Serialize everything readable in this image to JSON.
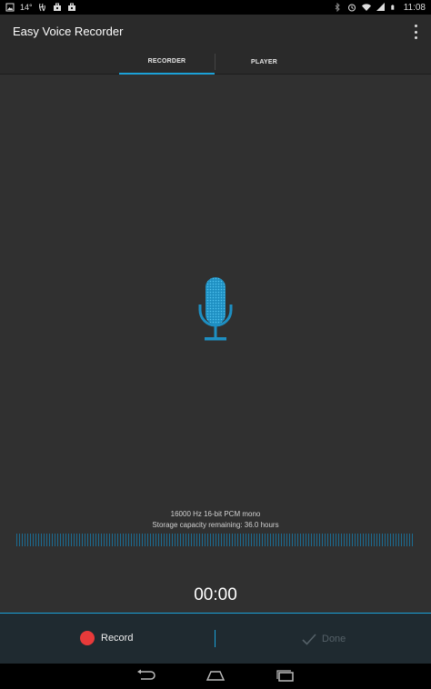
{
  "status_bar": {
    "left_icons": [
      "gallery-icon",
      "temperature-text",
      "hangouts-icon",
      "briefcase-icon",
      "briefcase-icon"
    ],
    "temperature": "14°",
    "right_icons": [
      "bluetooth-icon",
      "alarm-icon",
      "wifi-icon",
      "signal-icon",
      "battery-icon"
    ],
    "time": "11:08"
  },
  "action_bar": {
    "title": "Easy Voice Recorder",
    "overflow_icon": "more-vert-icon"
  },
  "tabs": [
    {
      "label": "RECORDER",
      "selected": true
    },
    {
      "label": "PLAYER",
      "selected": false
    }
  ],
  "recorder": {
    "mic_icon": "microphone-icon",
    "format_text": "16000 Hz 16-bit PCM mono",
    "storage_text": "Storage capacity remaining: 36.0 hours",
    "timer": "00:00"
  },
  "controls": {
    "record_label": "Record",
    "done_label": "Done",
    "record_color": "#e83a3a",
    "accent_color": "#1ba1d8"
  },
  "nav_bar": {
    "buttons": [
      "back-icon",
      "home-icon",
      "recents-icon"
    ]
  }
}
